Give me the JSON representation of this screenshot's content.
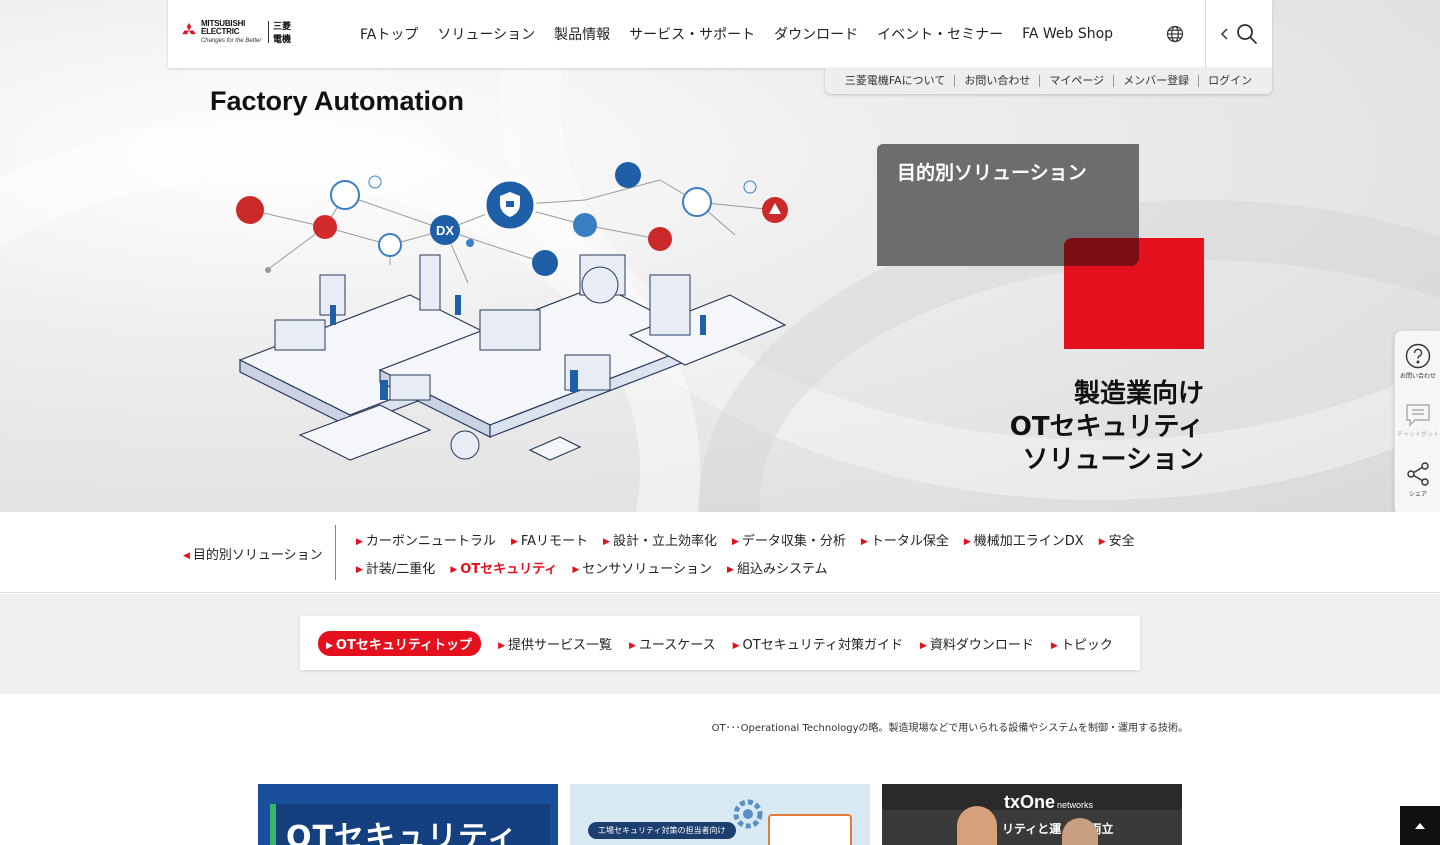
{
  "logo": {
    "brand_line": "MITSUBISHI ELECTRIC",
    "tagline": "Changes for the Better",
    "jp_name": "三菱電機"
  },
  "nav": {
    "items": [
      "FAトップ",
      "ソリューション",
      "製品情報",
      "サービス・サポート",
      "ダウンロード",
      "イベント・セミナー",
      "FA Web Shop"
    ]
  },
  "subnav": {
    "items": [
      "三菱電機FAについて",
      "お問い合わせ",
      "マイページ",
      "メンバー登録",
      "ログイン"
    ]
  },
  "hero": {
    "title": "Factory Automation",
    "solution_label": "目的別ソリューション",
    "copy_line1": "製造業向け",
    "copy_line2": "OTセキュリティ",
    "copy_line3": "ソリューション",
    "illustration_labels": {
      "dx": "DX"
    }
  },
  "side_widget": {
    "contact": "お問い合わせ",
    "chatbot": "チャットボット",
    "share": "シェア"
  },
  "category_bar": {
    "back_label": "目的別ソリューション",
    "row1": [
      "カーボンニュートラル",
      "FAリモート",
      "設計・立上効率化",
      "データ収集・分析",
      "トータル保全",
      "機械加工ラインDX",
      "安全"
    ],
    "row2": [
      "計装/二重化",
      "OTセキュリティ",
      "センサソリューション",
      "組込みシステム"
    ],
    "active": "OTセキュリティ"
  },
  "ot_tabs": {
    "items": [
      "OTセキュリティトップ",
      "提供サービス一覧",
      "ユースケース",
      "OTセキュリティ対策ガイド",
      "資料ダウンロード",
      "トピック"
    ],
    "active": "OTセキュリティトップ"
  },
  "note": "OT･･･Operational Technologyの略。製造現場などで用いられる設備やシステムを制御・運用する技術。",
  "cards": {
    "card1_text": "OTセキュリティ",
    "card2_pill": "工場セキュリティ対策の担当者向け",
    "card3_brand": "txOne",
    "card3_sub": "networks",
    "card3_banner": "リティと運  性の両立"
  },
  "colors": {
    "accent_red": "#e5101d",
    "dark_red": "#7c0f14",
    "gray_panel": "#6d6d6d",
    "navy": "#1a4f9c"
  }
}
